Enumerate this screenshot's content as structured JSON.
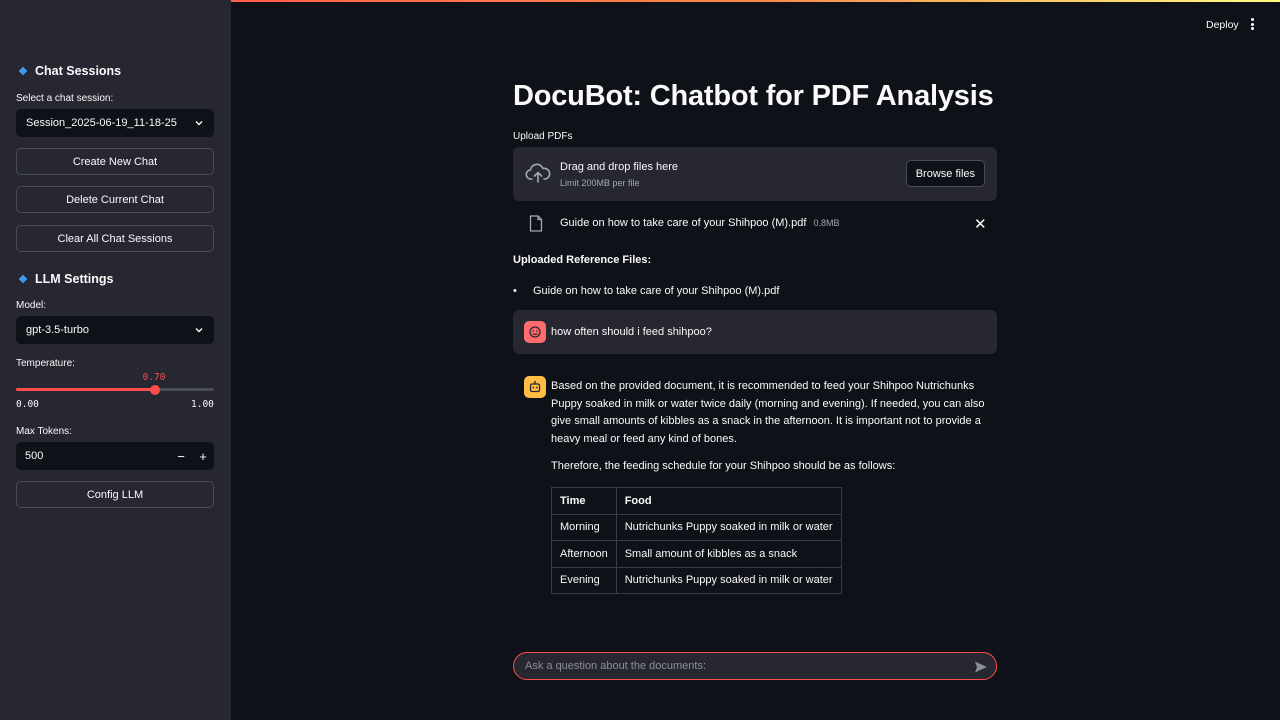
{
  "header": {
    "deploy_label": "Deploy"
  },
  "sidebar": {
    "chat_sessions_title": "Chat Sessions",
    "select_label": "Select a chat session:",
    "selected_session": "Session_2025-06-19_11-18-25",
    "create_label": "Create New Chat",
    "delete_label": "Delete Current Chat",
    "clear_label": "Clear All Chat Sessions",
    "llm_title": "LLM Settings",
    "model_label": "Model:",
    "model_value": "gpt-3.5-turbo",
    "temperature_label": "Temperature:",
    "temperature_value": "0.70",
    "temperature_fraction": 0.7,
    "temperature_min": "0.00",
    "temperature_max": "1.00",
    "max_tokens_label": "Max Tokens:",
    "max_tokens_value": "500",
    "minus": "−",
    "plus": "+",
    "config_label": "Config LLM"
  },
  "main": {
    "title": "DocuBot: Chatbot for PDF Analysis",
    "upload_label": "Upload PDFs",
    "dropzone_title": "Drag and drop files here",
    "dropzone_sub": "Limit 200MB per file",
    "browse_label": "Browse files",
    "file_name": "Guide on how to take care of your Shihpoo (M).pdf",
    "file_size": "0.8MB",
    "ref_title": "Uploaded Reference Files:",
    "ref_items": [
      "Guide on how to take care of your Shihpoo (M).pdf"
    ],
    "user_message": "how often should i feed shihpoo?",
    "bot_paragraph": "Based on the provided document, it is recommended to feed your Shihpoo Nutrichunks Puppy soaked in milk or water twice daily (morning and evening). If needed, you can also give small amounts of kibbles as a snack in the afternoon. It is important not to provide a heavy meal or feed any kind of bones.",
    "bot_paragraph2": "Therefore, the feeding schedule for your Shihpoo should be as follows:",
    "table": {
      "headers": [
        "Time",
        "Food"
      ],
      "rows": [
        [
          "Morning",
          "Nutrichunks Puppy soaked in milk or water"
        ],
        [
          "Afternoon",
          "Small amount of kibbles as a snack"
        ],
        [
          "Evening",
          "Nutrichunks Puppy soaked in milk or water"
        ]
      ]
    },
    "chat_placeholder": "Ask a question about the documents:"
  },
  "colors": {
    "accent": "#ff4b4b",
    "background": "#0e1117",
    "sidebar": "#262730",
    "user_avatar": "#ff6c6c",
    "bot_avatar": "#ffbd45"
  },
  "icons": [
    "chevron-down-icon",
    "cloud-upload-icon",
    "file-icon",
    "close-icon",
    "user-avatar-icon",
    "bot-avatar-icon",
    "send-icon",
    "more-vert-icon"
  ]
}
